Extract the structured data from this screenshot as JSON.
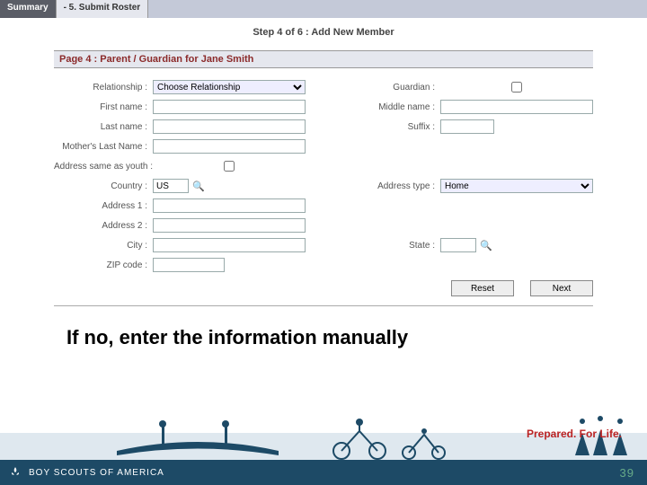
{
  "tabs": {
    "summary": "Summary",
    "submit": "- 5. Submit Roster"
  },
  "step": "Step 4 of 6 : Add New Member",
  "pageHeading": "Page 4 : Parent / Guardian for Jane Smith",
  "labels": {
    "relationship": "Relationship :",
    "guardian": "Guardian :",
    "first": "First name :",
    "middle": "Middle name :",
    "last": "Last name :",
    "suffix": "Suffix :",
    "motherLast": "Mother's Last Name :",
    "sameAddr": "Address same as youth :",
    "country": "Country :",
    "addrType": "Address type :",
    "addr1": "Address 1 :",
    "addr2": "Address 2 :",
    "city": "City :",
    "state": "State :",
    "zip": "ZIP code :"
  },
  "values": {
    "relationship": "Choose Relationship",
    "country": "US",
    "addrType": "Home",
    "first": "",
    "middle": "",
    "last": "",
    "suffix": "",
    "motherLast": "",
    "addr1": "",
    "addr2": "",
    "city": "",
    "state": "",
    "zip": ""
  },
  "buttons": {
    "reset": "Reset",
    "next": "Next"
  },
  "caption": "If no, enter the information manually",
  "tagline": "Prepared. For Life.",
  "brand": "BOY SCOUTS OF AMERICA",
  "pageNum": "39"
}
